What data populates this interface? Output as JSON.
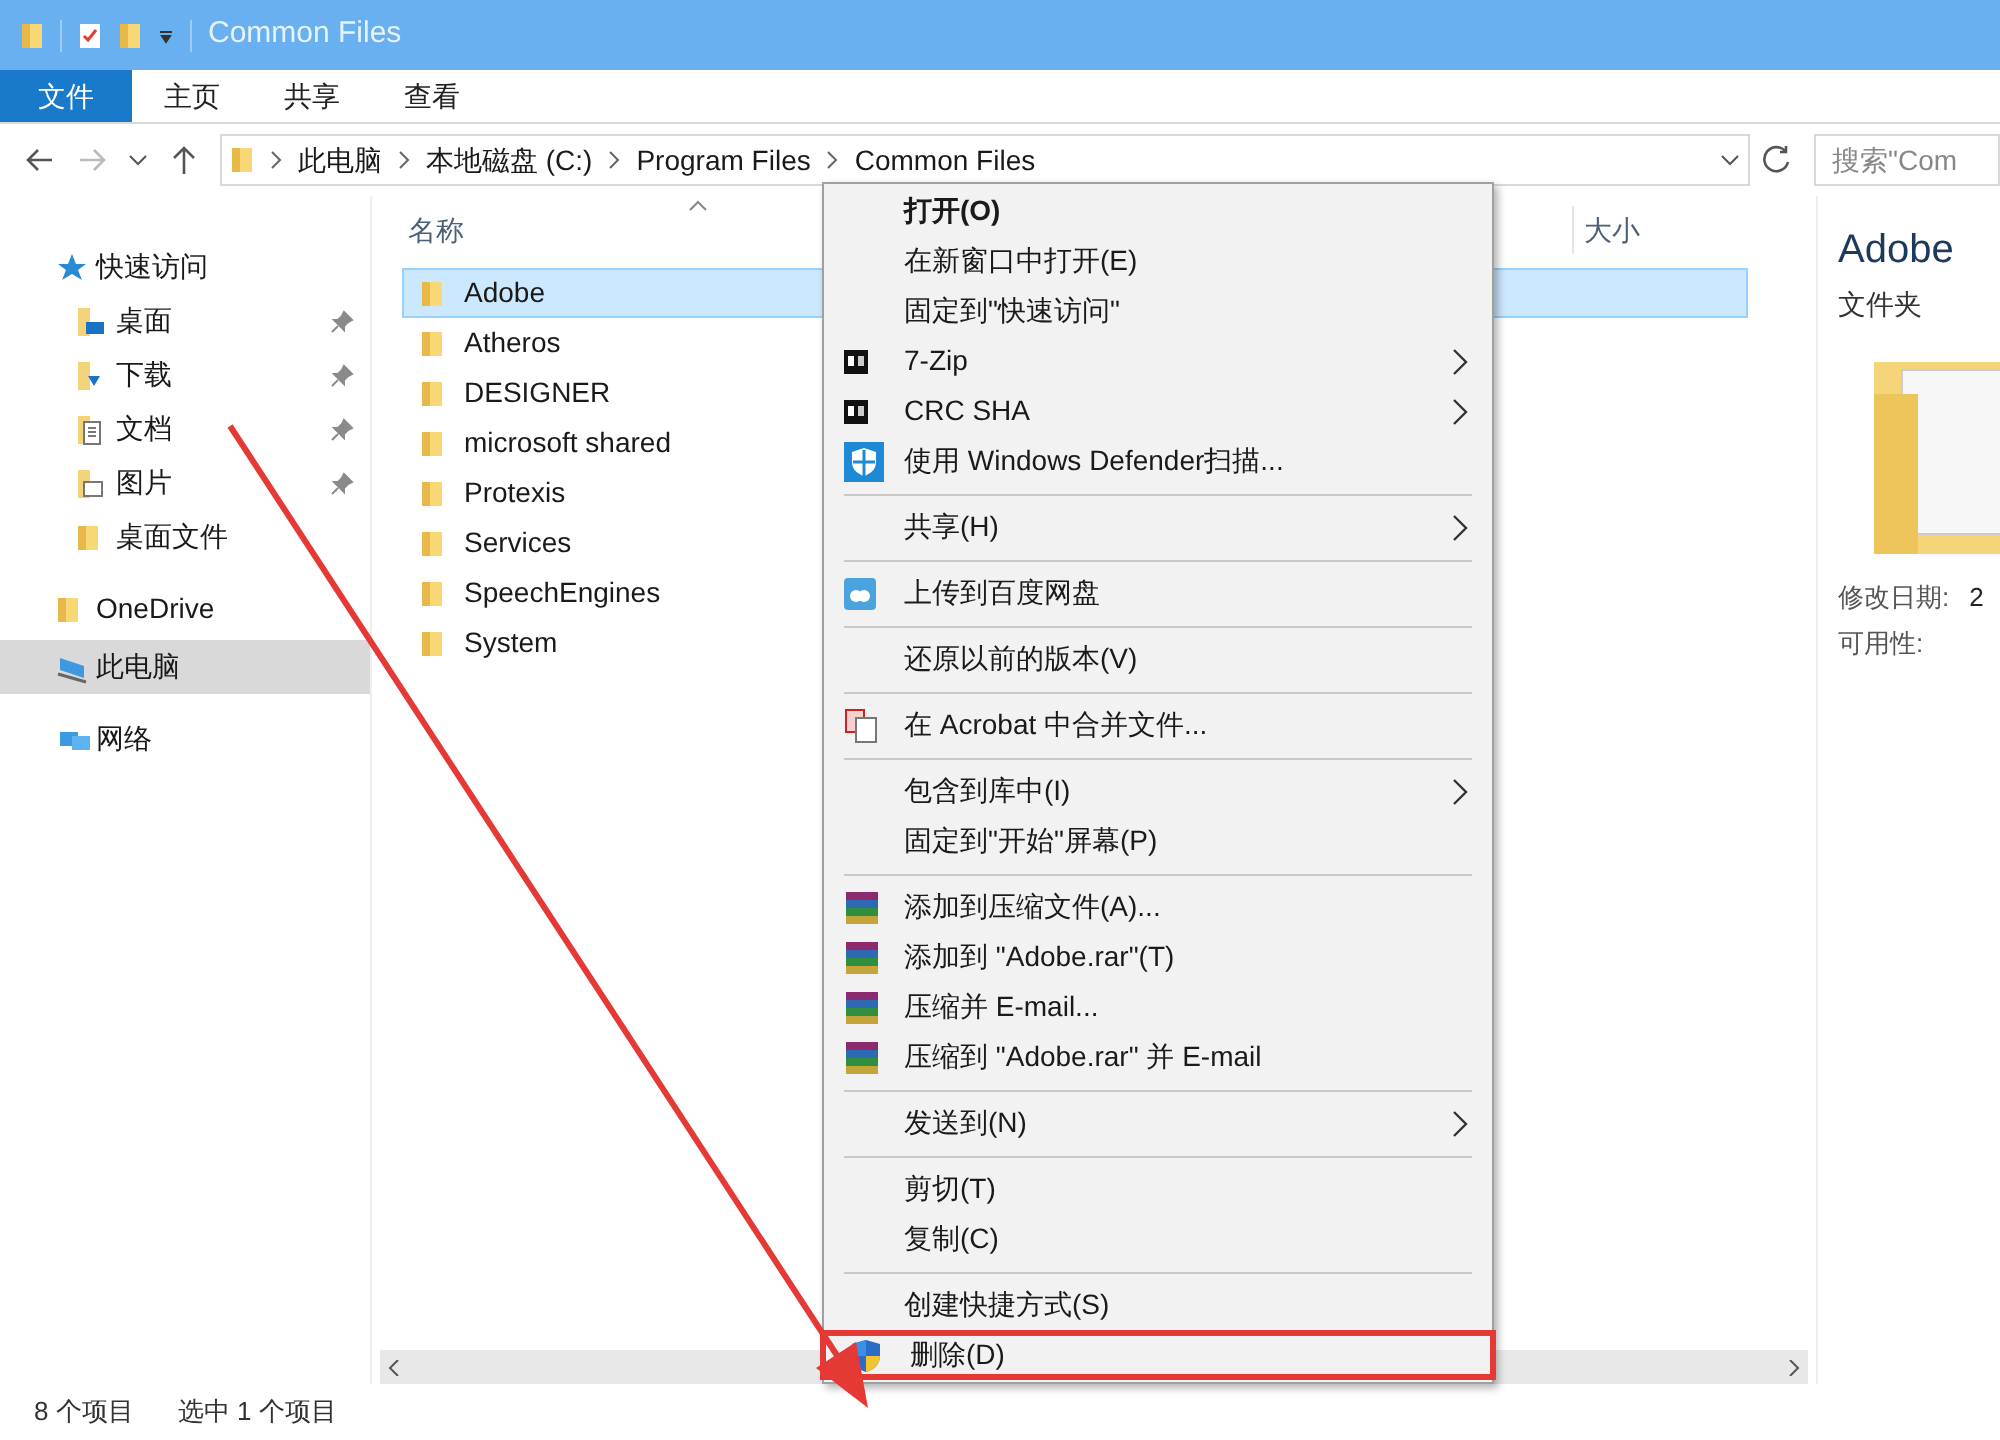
{
  "window": {
    "title": "Common Files"
  },
  "ribbon_tabs": [
    {
      "label": "文件",
      "selected": true
    },
    {
      "label": "主页",
      "selected": false
    },
    {
      "label": "共享",
      "selected": false
    },
    {
      "label": "查看",
      "selected": false
    }
  ],
  "breadcrumbs": [
    "此电脑",
    "本地磁盘 (C:)",
    "Program Files",
    "Common Files"
  ],
  "search": {
    "placeholder": "搜索\"Com"
  },
  "sidebar": {
    "items": [
      {
        "label": "快速访问",
        "kind": "star",
        "selected": false,
        "children": [
          {
            "label": "桌面",
            "kind": "desktop",
            "pinned": true,
            "selected": false
          },
          {
            "label": "下载",
            "kind": "download",
            "pinned": true,
            "selected": false
          },
          {
            "label": "文档",
            "kind": "document",
            "pinned": true,
            "selected": false
          },
          {
            "label": "图片",
            "kind": "picture",
            "pinned": true,
            "selected": false
          },
          {
            "label": "桌面文件",
            "kind": "folder",
            "pinned": false,
            "selected": false
          }
        ]
      },
      {
        "label": "OneDrive",
        "kind": "folder",
        "selected": false
      },
      {
        "label": "此电脑",
        "kind": "computer",
        "selected": true
      },
      {
        "label": "网络",
        "kind": "network",
        "selected": false
      }
    ]
  },
  "file_list": {
    "columns": [
      "名称",
      "大小"
    ],
    "rows": [
      {
        "name": "Adobe",
        "selected": true
      },
      {
        "name": "Atheros",
        "selected": false
      },
      {
        "name": "DESIGNER",
        "selected": false
      },
      {
        "name": "microsoft shared",
        "selected": false
      },
      {
        "name": "Protexis",
        "selected": false
      },
      {
        "name": "Services",
        "selected": false
      },
      {
        "name": "SpeechEngines",
        "selected": false
      },
      {
        "name": "System",
        "selected": false
      }
    ]
  },
  "details": {
    "name": "Adobe",
    "type": "文件夹",
    "fields": [
      {
        "label": "修改日期:",
        "value": "2"
      },
      {
        "label": "可用性:"
      }
    ]
  },
  "context_menu": [
    {
      "kind": "plain",
      "label": "打开(O)",
      "bold": true
    },
    {
      "kind": "plain",
      "label": "在新窗口中打开(E)"
    },
    {
      "kind": "plain",
      "label": "固定到\"快速访问\""
    },
    {
      "kind": "archive",
      "label": "7-Zip",
      "submenu": true
    },
    {
      "kind": "archive",
      "label": "CRC SHA",
      "submenu": true
    },
    {
      "kind": "shield",
      "label": "使用 Windows Defender扫描..."
    },
    {
      "kind": "separator"
    },
    {
      "kind": "plain",
      "label": "共享(H)",
      "submenu": true
    },
    {
      "kind": "separator"
    },
    {
      "kind": "cloud",
      "label": "上传到百度网盘"
    },
    {
      "kind": "separator"
    },
    {
      "kind": "plain",
      "label": "还原以前的版本(V)"
    },
    {
      "kind": "separator"
    },
    {
      "kind": "documents",
      "label": "在 Acrobat 中合并文件..."
    },
    {
      "kind": "separator"
    },
    {
      "kind": "plain",
      "label": "包含到库中(I)",
      "submenu": true
    },
    {
      "kind": "plain",
      "label": "固定到\"开始\"屏幕(P)"
    },
    {
      "kind": "separator"
    },
    {
      "kind": "books",
      "label": "添加到压缩文件(A)..."
    },
    {
      "kind": "books",
      "label": "添加到 \"Adobe.rar\"(T)"
    },
    {
      "kind": "books",
      "label": "压缩并 E-mail..."
    },
    {
      "kind": "books",
      "label": "压缩到 \"Adobe.rar\" 并 E-mail"
    },
    {
      "kind": "separator"
    },
    {
      "kind": "plain",
      "label": "发送到(N)",
      "submenu": true
    },
    {
      "kind": "separator"
    },
    {
      "kind": "plain",
      "label": "剪切(T)"
    },
    {
      "kind": "plain",
      "label": "复制(C)"
    },
    {
      "kind": "separator"
    },
    {
      "kind": "plain",
      "label": "创建快捷方式(S)"
    },
    {
      "kind": "uac",
      "label": "删除(D)",
      "highlighted": true
    }
  ],
  "status_bar": [
    "8 个项目",
    "选中 1 个项目"
  ]
}
